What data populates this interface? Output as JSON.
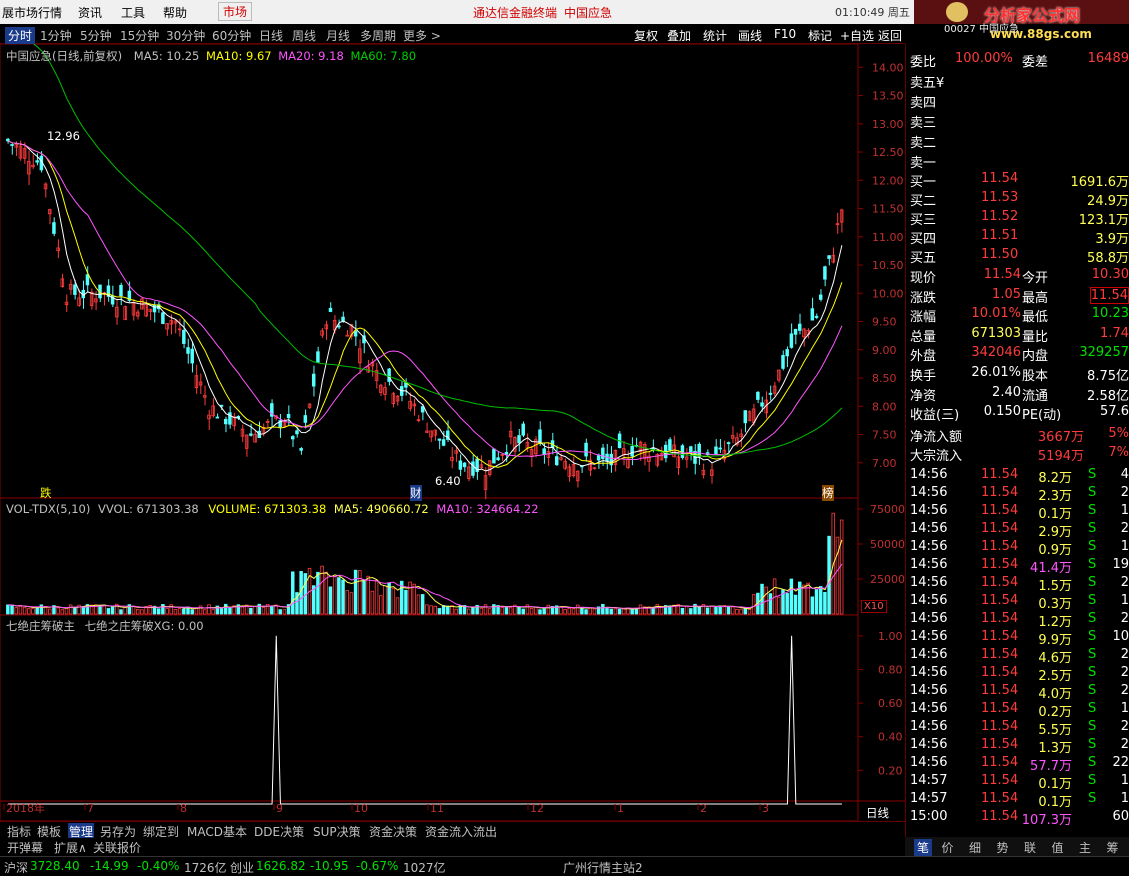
{
  "menubar": {
    "items": [
      "展市场行情",
      "资讯",
      "工具",
      "帮助"
    ],
    "market": "市场",
    "title": "通达信金融终端",
    "stock": "中国应急",
    "time": "01:10:49 周五",
    "logo": "分析家公式网",
    "logo_url": "www.88gs.com",
    "logo_sub": "00027 中国应急"
  },
  "toolbar": {
    "periods": [
      "分时",
      "1分钟",
      "5分钟",
      "15分钟",
      "30分钟",
      "60分钟",
      "日线",
      "周线",
      "月线",
      "多周期",
      "更多 >"
    ],
    "buttons": [
      "复权",
      "叠加",
      "统计",
      "画线",
      "F10",
      "标记",
      "+自选",
      "返回"
    ]
  },
  "main_legend": {
    "name": "中国应急(日线,前复权)",
    "ma5": "MA5: 10.25",
    "ma10": "MA10: 9.67",
    "ma20": "MA20: 9.18",
    "ma60": "MA60: 7.80"
  },
  "vol_legend": {
    "name": "VOL-TDX(5,10)",
    "vvol": "VVOL: 671303.38",
    "volume": "VOLUME: 671303.38",
    "ma5": "MA5: 490660.72",
    "ma10": "MA10: 324664.22"
  },
  "ind_legend": {
    "name": "七绝庄筹破主",
    "series": "七绝之庄筹破XG: 0.00"
  },
  "annotations": {
    "high": "12.96",
    "low": "6.40",
    "marker1": "跌",
    "marker2": "财",
    "marker3": "榜"
  },
  "chart_data": [
    {
      "type": "candlestick",
      "title": "中国应急(日线,前复权)",
      "ylim": [
        6.5,
        14.2
      ],
      "yticks": [
        "14.00",
        "13.50",
        "13.00",
        "12.50",
        "12.00",
        "11.50",
        "11.00",
        "10.50",
        "10.00",
        "9.50",
        "9.00",
        "8.50",
        "8.00",
        "7.50",
        "7.00"
      ],
      "x_labels": [
        "2018年",
        "7",
        "8",
        "9",
        "10",
        "11",
        "12",
        "1",
        "2",
        "3"
      ],
      "series": [
        {
          "name": "MA5"
        },
        {
          "name": "MA10"
        },
        {
          "name": "MA20"
        },
        {
          "name": "MA60"
        }
      ]
    },
    {
      "type": "bar",
      "title": "VOL-TDX(5,10)",
      "ylim": [
        0,
        80000
      ],
      "yticks": [
        "75000",
        "50000",
        "25000"
      ],
      "unit": "X10",
      "series": [
        {
          "name": "VOLUME"
        },
        {
          "name": "MA5"
        },
        {
          "name": "MA10"
        }
      ]
    },
    {
      "type": "line",
      "title": "七绝庄筹破主",
      "ylim": [
        0,
        1.1
      ],
      "yticks": [
        "1.00",
        "0.80",
        "0.60",
        "0.40",
        "0.20"
      ],
      "series": [
        {
          "name": "七绝之庄筹破XG",
          "values": [
            0,
            1,
            0,
            1,
            0
          ]
        }
      ]
    }
  ],
  "bottom_tabs": [
    "指标",
    "模板",
    "管理",
    "另存为",
    "绑定到",
    "MACD基本",
    "DDE决策",
    "SUP决策",
    "资金决策",
    "资金流入流出"
  ],
  "bottom_tabs2": [
    "开弹幕",
    "扩展∧",
    "关联报价"
  ],
  "x_axis_mode": "日线",
  "right_panel": {
    "weibi": {
      "label": "委比",
      "value": "100.00%",
      "label2": "委差",
      "value2": "16489"
    },
    "sells": [
      {
        "label": "卖五",
        "mark": "¥"
      },
      {
        "label": "卖四"
      },
      {
        "label": "卖三"
      },
      {
        "label": "卖二"
      },
      {
        "label": "卖一"
      }
    ],
    "buys": [
      {
        "label": "买一",
        "price": "11.54",
        "vol": "1691.6万"
      },
      {
        "label": "买二",
        "price": "11.53",
        "vol": "24.9万"
      },
      {
        "label": "买三",
        "price": "11.52",
        "vol": "123.1万"
      },
      {
        "label": "买四",
        "price": "11.51",
        "vol": "3.9万"
      },
      {
        "label": "买五",
        "price": "11.50",
        "vol": "58.8万"
      }
    ],
    "quote": [
      {
        "l1": "现价",
        "v1": "11.54",
        "l2": "今开",
        "v2": "10.30"
      },
      {
        "l1": "涨跌",
        "v1": "1.05",
        "l2": "最高",
        "v2": "11.54"
      },
      {
        "l1": "涨幅",
        "v1": "10.01%",
        "l2": "最低",
        "v2": "10.23"
      },
      {
        "l1": "总量",
        "v1": "671303",
        "l2": "量比",
        "v2": "1.74"
      },
      {
        "l1": "外盘",
        "v1": "342046",
        "l2": "内盘",
        "v2": "329257"
      },
      {
        "l1": "换手",
        "v1": "26.01%",
        "l2": "股本",
        "v2": "8.75亿"
      },
      {
        "l1": "净资",
        "v1": "2.40",
        "l2": "流通",
        "v2": "2.58亿"
      },
      {
        "l1": "收益(三)",
        "v1": "0.150",
        "l2": "PE(动)",
        "v2": "57.6"
      }
    ],
    "flows": [
      {
        "label": "净流入额",
        "value": "3667万",
        "pct": "5%"
      },
      {
        "label": "大宗流入",
        "value": "5194万",
        "pct": "7%"
      }
    ],
    "ticks": [
      {
        "t": "14:56",
        "p": "11.54",
        "v": "8.2万",
        "s": "S",
        "n": "4"
      },
      {
        "t": "14:56",
        "p": "11.54",
        "v": "2.3万",
        "s": "S",
        "n": "2"
      },
      {
        "t": "14:56",
        "p": "11.54",
        "v": "0.1万",
        "s": "S",
        "n": "1"
      },
      {
        "t": "14:56",
        "p": "11.54",
        "v": "2.9万",
        "s": "S",
        "n": "2"
      },
      {
        "t": "14:56",
        "p": "11.54",
        "v": "0.9万",
        "s": "S",
        "n": "1"
      },
      {
        "t": "14:56",
        "p": "11.54",
        "v": "41.4万",
        "s": "S",
        "n": "19"
      },
      {
        "t": "14:56",
        "p": "11.54",
        "v": "1.5万",
        "s": "S",
        "n": "2"
      },
      {
        "t": "14:56",
        "p": "11.54",
        "v": "0.3万",
        "s": "S",
        "n": "1"
      },
      {
        "t": "14:56",
        "p": "11.54",
        "v": "1.2万",
        "s": "S",
        "n": "2"
      },
      {
        "t": "14:56",
        "p": "11.54",
        "v": "9.9万",
        "s": "S",
        "n": "10"
      },
      {
        "t": "14:56",
        "p": "11.54",
        "v": "4.6万",
        "s": "S",
        "n": "2"
      },
      {
        "t": "14:56",
        "p": "11.54",
        "v": "2.5万",
        "s": "S",
        "n": "2"
      },
      {
        "t": "14:56",
        "p": "11.54",
        "v": "4.0万",
        "s": "S",
        "n": "2"
      },
      {
        "t": "14:56",
        "p": "11.54",
        "v": "0.2万",
        "s": "S",
        "n": "1"
      },
      {
        "t": "14:56",
        "p": "11.54",
        "v": "5.5万",
        "s": "S",
        "n": "2"
      },
      {
        "t": "14:56",
        "p": "11.54",
        "v": "1.3万",
        "s": "S",
        "n": "2"
      },
      {
        "t": "14:56",
        "p": "11.54",
        "v": "57.7万",
        "s": "S",
        "n": "22"
      },
      {
        "t": "14:57",
        "p": "11.54",
        "v": "0.1万",
        "s": "S",
        "n": "1"
      },
      {
        "t": "14:57",
        "p": "11.54",
        "v": "0.1万",
        "s": "S",
        "n": "1"
      },
      {
        "t": "15:00",
        "p": "11.54",
        "v": "107.3万",
        "s": "",
        "n": "60"
      }
    ],
    "tabs": [
      "笔",
      "价",
      "细",
      "势",
      "联",
      "值",
      "主",
      "筹"
    ]
  },
  "status": {
    "sh_label": "沪深",
    "sh_val": "3728.40",
    "sh_chg": "-14.99",
    "sh_pct": "-0.40%",
    "sh_amt": "1726亿",
    "cy_label": "创业",
    "cy_val": "1626.82",
    "cy_chg": "-10.95",
    "cy_pct": "-0.67%",
    "cy_amt": "1027亿",
    "server": "广州行情主站2"
  },
  "colors": {
    "up": "#ff3c3c",
    "down": "#54ffff",
    "ma5": "#ffffff",
    "ma10": "#ffff00",
    "ma20": "#ff55ff",
    "ma60": "#00c000"
  }
}
